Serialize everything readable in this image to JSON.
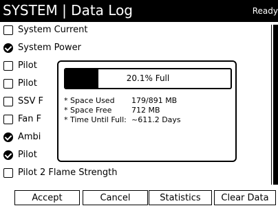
{
  "header": {
    "title": "SYSTEM | Data Log",
    "status": "Ready"
  },
  "items": [
    {
      "label": "System Current",
      "checked": false
    },
    {
      "label": "System Power",
      "checked": true
    },
    {
      "label": "Pilot",
      "checked": false
    },
    {
      "label": "Pilot",
      "checked": false
    },
    {
      "label": "SSV F",
      "checked": false
    },
    {
      "label": "Fan F",
      "checked": false
    },
    {
      "label": "Ambi",
      "checked": true
    },
    {
      "label": "Pilot",
      "checked": true
    },
    {
      "label": "Pilot 2 Flame Strength",
      "checked": false
    }
  ],
  "dialog": {
    "progress_text": "20.1% Full",
    "progress_fraction": 0.201,
    "info": [
      {
        "key": "* Space Used",
        "value": "179/891 MB"
      },
      {
        "key": "* Space Free",
        "value": "712 MB"
      },
      {
        "key": "* Time Until Full:",
        "value": "~611.2 Days"
      }
    ]
  },
  "buttons": {
    "accept": "Accept",
    "cancel": "Cancel",
    "statistics": "Statistics",
    "clear": "Clear Data"
  }
}
